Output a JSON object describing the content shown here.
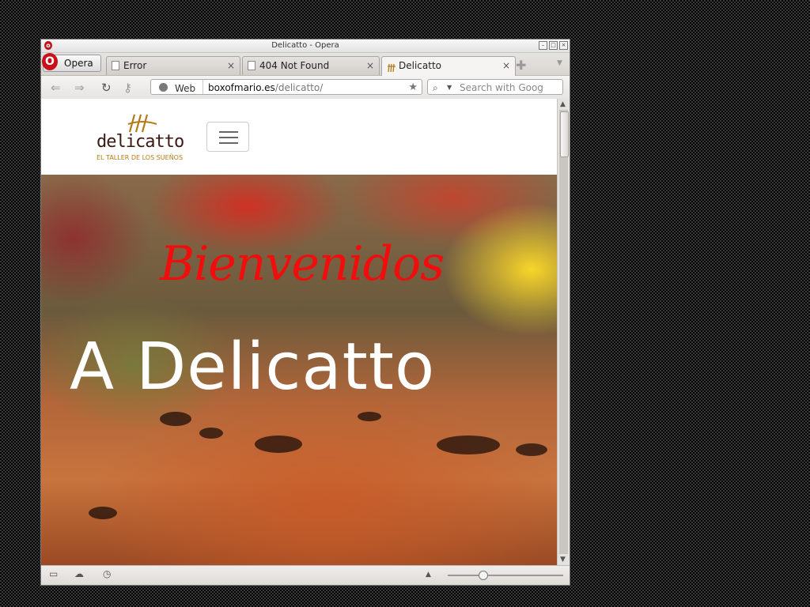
{
  "window": {
    "title": "Delicatto - Opera"
  },
  "opera_button": {
    "label": "Opera",
    "logo": "O"
  },
  "tabs": [
    {
      "label": "Error",
      "close": "×",
      "icon": "document-icon"
    },
    {
      "label": "404 Not Found",
      "close": "×",
      "icon": "document-icon"
    },
    {
      "label": "Delicatto",
      "close": "×",
      "icon": "delicatto-favicon",
      "active": true
    }
  ],
  "tabbar": {
    "add_glyph": "✚",
    "menu_glyph": "▼"
  },
  "addressbar": {
    "badge": "Web",
    "url_host": "boxofmario.es",
    "url_path": "/delicatto/",
    "search_placeholder": "Search with Goog"
  },
  "site": {
    "logo_word": "delicatto",
    "logo_tagline": "EL TALLER DE LOS SUEÑOS",
    "hero_script": "Bienvenidos",
    "hero_title": "A Delicatto"
  },
  "statusbar": {
    "zoom_level_fraction": 0.3
  },
  "colors": {
    "script_red": "#f20d0d",
    "logo_brown": "#3a1a12",
    "logo_gold": "#b47a16",
    "opera_red": "#c8101b"
  }
}
